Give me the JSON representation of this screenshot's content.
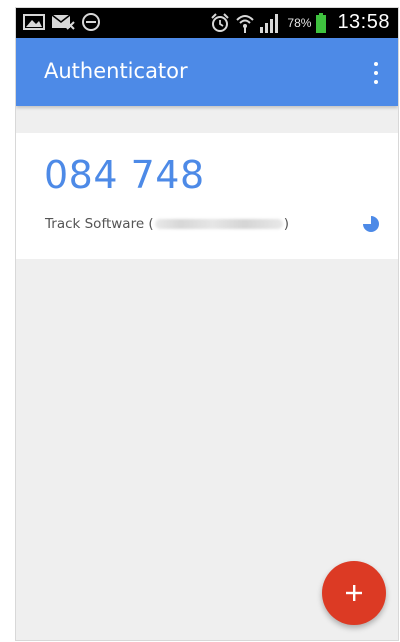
{
  "status_bar": {
    "left_icons": [
      "image-icon",
      "mail-icon",
      "do-not-disturb-icon"
    ],
    "right_icons": [
      "alarm-icon",
      "wifi-icon",
      "signal-icon",
      "battery-icon"
    ],
    "battery": "78%",
    "time": "13:58"
  },
  "app_bar": {
    "title": "Authenticator",
    "menu_icon": "overflow-menu-icon"
  },
  "account": {
    "code": "084 748",
    "issuer_prefix": "Track Software (",
    "issuer_suffix": ")",
    "timer_icon": "countdown-timer-icon"
  },
  "fab": {
    "icon": "plus-icon"
  },
  "colors": {
    "accent": "#4d8ae7",
    "fab": "#dc3a24",
    "background": "#efefef"
  }
}
